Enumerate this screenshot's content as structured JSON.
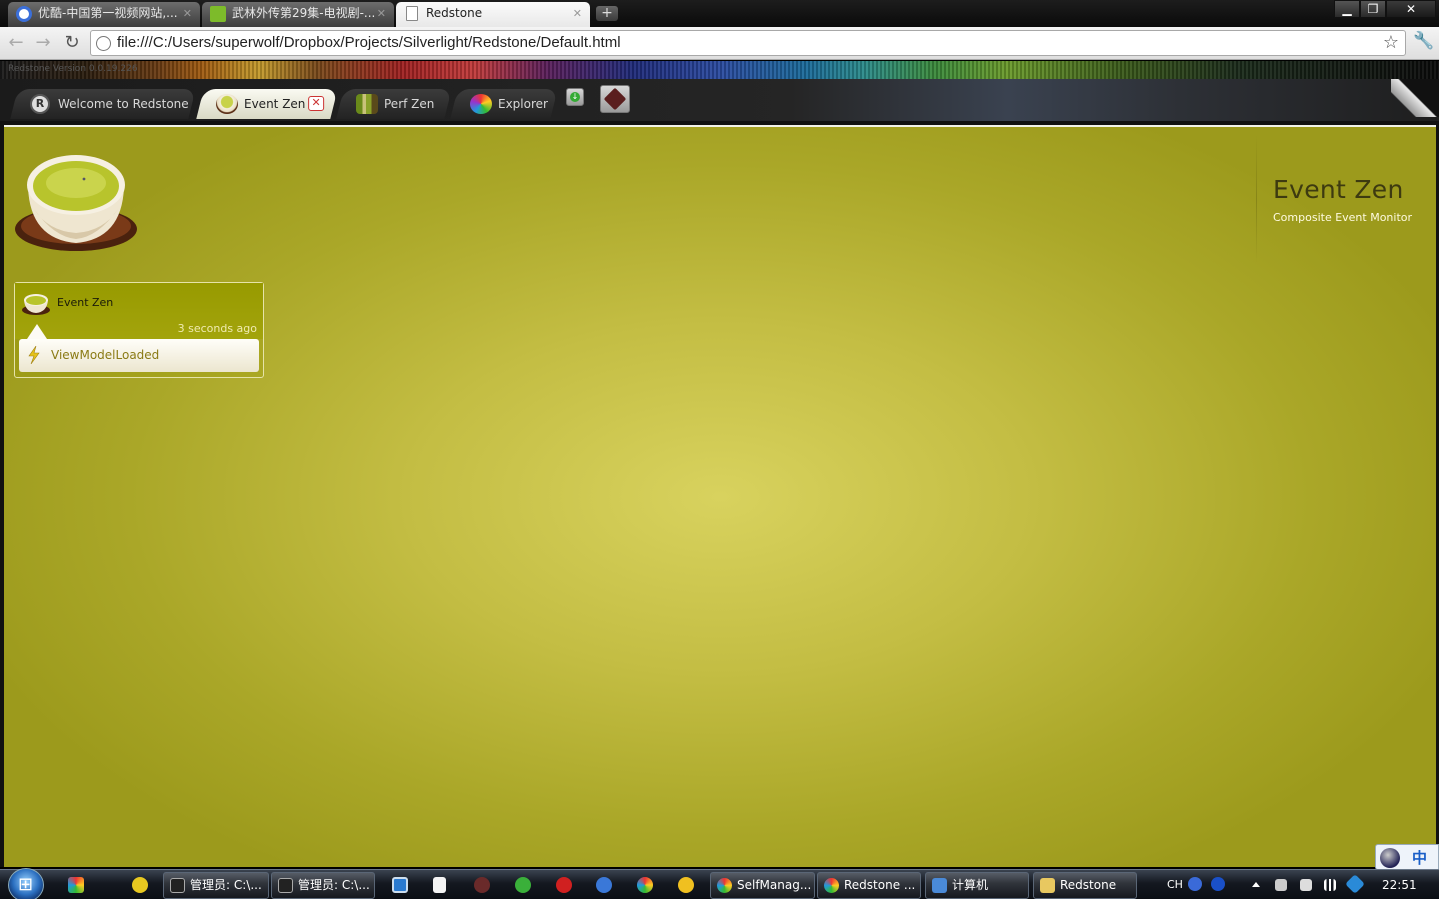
{
  "browser": {
    "tabs": [
      {
        "title": "优酷-中国第一视频网站,...",
        "favicon": "youku-icon",
        "active": false
      },
      {
        "title": "武林外传第29集-电视剧-...",
        "favicon": "qiyi-icon",
        "active": false
      },
      {
        "title": "Redstone",
        "favicon": "page-icon",
        "active": true
      }
    ],
    "new_tab": "+",
    "url": "file:///C:/Users/superwolf/Dropbox/Projects/Silverlight/Redstone/Default.html",
    "window_controls": {
      "minimize": "▁",
      "maximize": "❐",
      "close": "✕"
    }
  },
  "app": {
    "version": "Redstone Version 0.0.19.226",
    "tabs": [
      {
        "label": "Welcome to Redstone",
        "icon": "redstone-r-icon"
      },
      {
        "label": "Event Zen",
        "icon": "teacup-icon",
        "active": true,
        "close": "✕"
      },
      {
        "label": "Perf Zen",
        "icon": "bamboo-icon"
      },
      {
        "label": "Explorer",
        "icon": "explorer-icon"
      }
    ],
    "title": "Event Zen",
    "subtitle": "Composite Event Monitor",
    "event_card": {
      "source": "Event Zen",
      "time": "3 seconds ago",
      "event": "ViewModelLoaded"
    }
  },
  "ime": {
    "lang": "中"
  },
  "taskbar": {
    "tasks": [
      {
        "label": "管理员: C:\\..."
      },
      {
        "label": "管理员: C:\\..."
      },
      {
        "label": "SelfManag..."
      },
      {
        "label": "Redstone ..."
      },
      {
        "label": "计算机"
      },
      {
        "label": "Redstone"
      }
    ],
    "tray_lang": "CH",
    "clock": "22:51"
  },
  "colors": {
    "stage_center": "#d8d25e",
    "stage_edge": "#9c9a1c",
    "title_text": "#3d3a10",
    "event_text": "#8a7a14"
  }
}
